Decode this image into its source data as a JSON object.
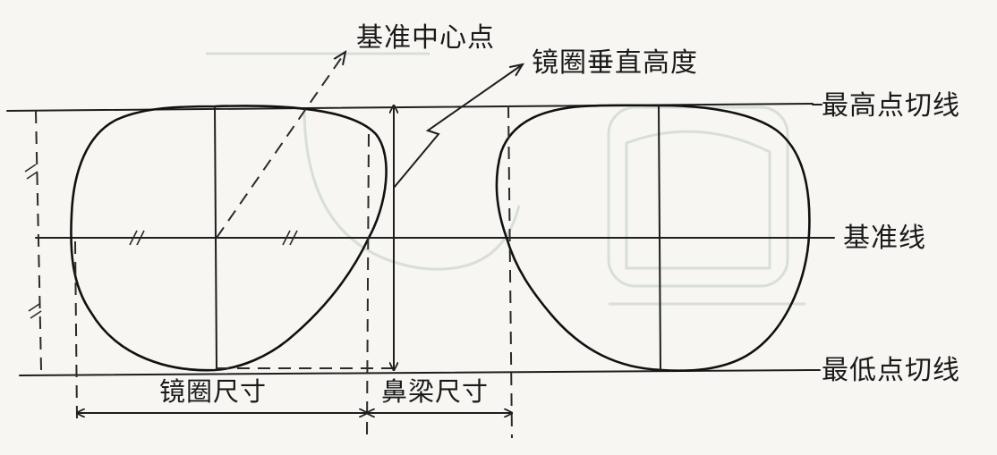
{
  "labels": {
    "reference_center_point": "基准中心点",
    "frame_vertical_height": "镜圈垂直高度",
    "top_tangent_line": "最高点切线",
    "reference_line": "基准线",
    "bottom_tangent_line": "最低点切线",
    "frame_size": "镜圈尺寸",
    "bridge_size": "鼻梁尺寸"
  },
  "colors": {
    "ink": "#1e1e1e",
    "paper": "#f7f6f2"
  }
}
